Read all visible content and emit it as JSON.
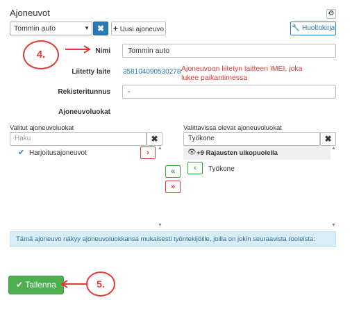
{
  "header": {
    "title": "Ajoneuvot",
    "gear_icon": "gear-icon"
  },
  "toolbar": {
    "vehicle_select_value": "Tommin auto",
    "remove_icon": "close-icon",
    "new_vehicle_label": "Uusi ajoneuvo",
    "logbook_label": "Huoltokirja"
  },
  "annotations": {
    "step4": "4.",
    "step5": "5.",
    "note": "Ajoneuvoon liitetyn laitteen IMEI, joka lukee paikantimessa"
  },
  "form": {
    "name_label": "Nimi",
    "name_value": "Tommin auto",
    "device_label": "Liitetty laite",
    "device_value": "358104090530278",
    "regnum_label": "Rekisteritunnus",
    "regnum_value": "-",
    "classes_heading": "Ajoneuvoluokat"
  },
  "selected": {
    "header": "Valitut ajoneuvoluokat",
    "search_placeholder": "Haku",
    "items": [
      {
        "label": "Harjoitusajoneuvot"
      }
    ]
  },
  "available": {
    "header": "Valittavissa olevat ajoneuvoluokat",
    "search_value": "Työkone",
    "filtered_text": "+9 Rajausten ulkopuolella",
    "items": [
      {
        "label": "Työkone"
      }
    ]
  },
  "info": {
    "text": "Tämä ajoneuvo näkyy ajoneuvoluokkansa mukaisesti työntekijöille, joilla on jokin seuraavista rooleista:"
  },
  "actions": {
    "save_label": "Tallenna"
  },
  "colors": {
    "primary": "#2a7ab8",
    "success": "#4caf50",
    "danger": "#e53935",
    "info_bg": "#d9edf7"
  }
}
